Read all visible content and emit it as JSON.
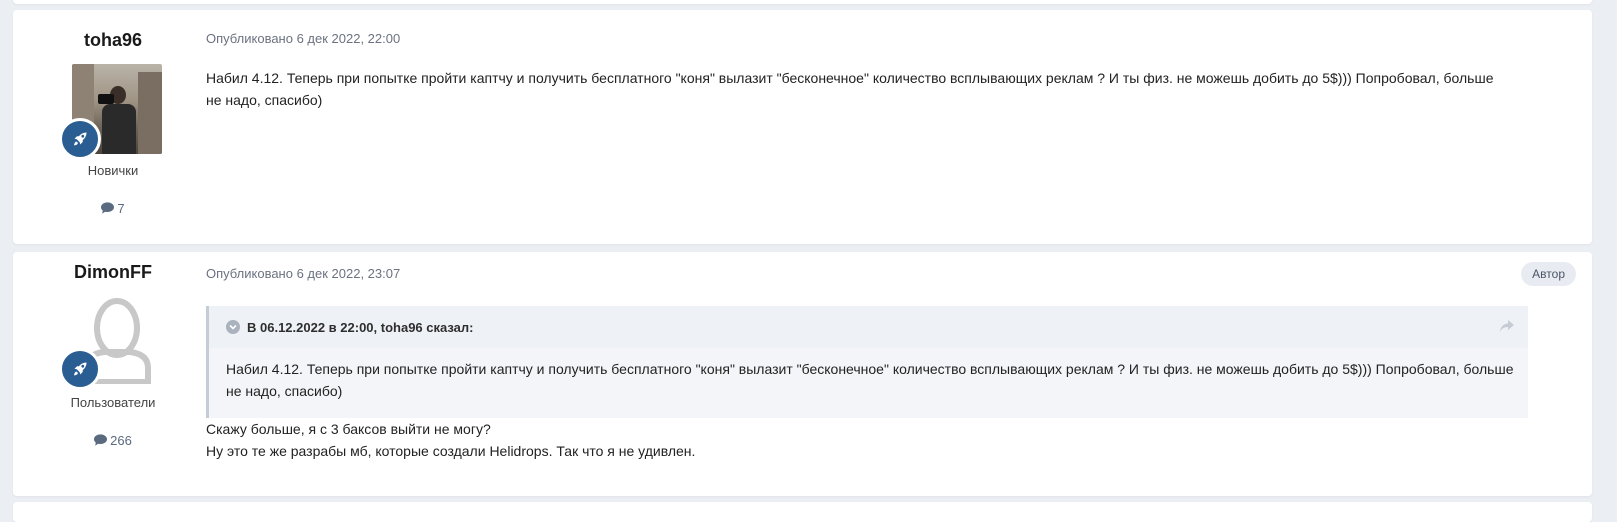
{
  "posts": [
    {
      "author": "toha96",
      "group": "Новички",
      "post_count": "7",
      "date": "Опубликовано 6 дек 2022, 22:00",
      "text": "Набил 4.12. Теперь при попытке пройти каптчу и получить бесплатного \"коня\" вылазит \"бесконечное\" количество всплывающих реклам ? И ты физ. не можешь добить до 5$))) Попробовал, больше не надо, спасибо)"
    },
    {
      "author": "DimonFF",
      "group": "Пользователи",
      "post_count": "266",
      "date": "Опубликовано 6 дек 2022, 23:07",
      "author_badge": "Автор",
      "quote": {
        "header": "В 06.12.2022 в 22:00, toha96 сказал:",
        "text": "Набил 4.12. Теперь при попытке пройти каптчу и получить бесплатного \"коня\" вылазит \"бесконечное\" количество всплывающих реклам ? И ты физ. не можешь добить до 5$))) Попробовал, больше не надо, спасибо)"
      },
      "lines": [
        "Скажу больше, я с 3 баксов выйти не могу?",
        "Ну это те же разрабы мб, которые создали Helidrops. Так что я не удивлен."
      ]
    }
  ],
  "icons": {
    "rank": "rocket-icon",
    "post_count": "comment-icon",
    "quote_toggle": "chevron-down-icon",
    "quote_share": "share-icon"
  },
  "colors": {
    "rank_badge": "#2a5d91",
    "page_bg": "#ebeef2"
  }
}
